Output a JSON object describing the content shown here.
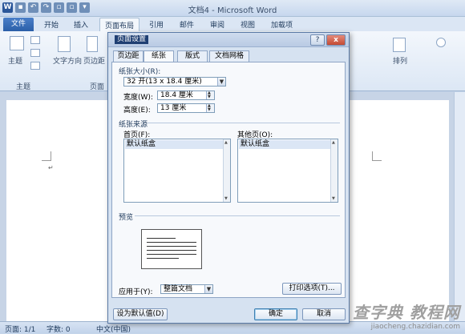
{
  "window": {
    "title": "文档4 - Microsoft Word",
    "word_logo": "W"
  },
  "ribbon_tabs": {
    "file": "文件",
    "items": [
      "开始",
      "插入",
      "页面布局",
      "引用",
      "邮件",
      "审阅",
      "视图",
      "加载项"
    ],
    "active_index": 2
  },
  "ribbon": {
    "theme_label": "主题",
    "group_theme": "主题",
    "text_direction": "文字方向",
    "margins": "页边距",
    "group_page": "页面",
    "arrange": "排列"
  },
  "dialog": {
    "title": "页面设置",
    "help": "?",
    "close": "x",
    "tabs": [
      "页边距",
      "纸张",
      "版式",
      "文档网格"
    ],
    "active_tab": 1,
    "paper_size_section": "纸张大小(R):",
    "paper_size_value": "32 开(13 x 18.4 厘米)",
    "width_label": "宽度(W):",
    "width_value": "18.4 厘米",
    "height_label": "高度(E):",
    "height_value": "13 厘米",
    "paper_source_section": "纸张来源",
    "first_page_label": "首页(F):",
    "first_page_item": "默认纸盒",
    "other_pages_label": "其他页(O):",
    "other_pages_item": "默认纸盒",
    "preview_section": "预览",
    "apply_to_label": "应用于(Y):",
    "apply_to_value": "整篇文档",
    "print_options_button": "打印选项(T)...",
    "set_default_button": "设为默认值(D)",
    "ok_button": "确定",
    "cancel_button": "取消"
  },
  "statusbar": {
    "page": "页面: 1/1",
    "words": "字数: 0",
    "language": "中文(中国)"
  },
  "watermark": {
    "logo": "查字典 教程网",
    "url": "jiaocheng.chazidian.com"
  }
}
